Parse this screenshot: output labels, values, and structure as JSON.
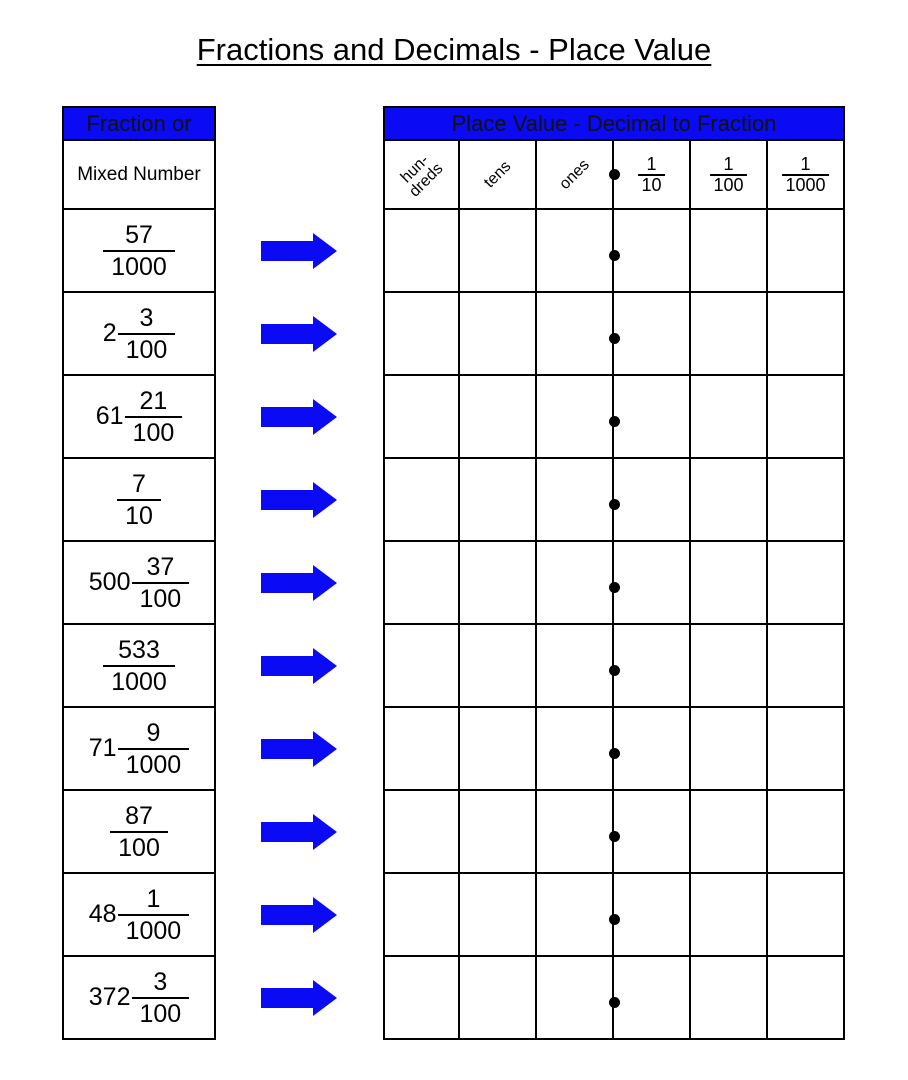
{
  "title": "Fractions and Decimals - Place Value",
  "left_table": {
    "header_line1": "Fraction or",
    "header_line2": "Mixed Number",
    "rows": [
      {
        "whole": "",
        "numerator": "57",
        "denominator": "1000"
      },
      {
        "whole": "2",
        "numerator": "3",
        "denominator": "100"
      },
      {
        "whole": "61",
        "numerator": "21",
        "denominator": "100"
      },
      {
        "whole": "",
        "numerator": "7",
        "denominator": "10"
      },
      {
        "whole": "500",
        "numerator": "37",
        "denominator": "100"
      },
      {
        "whole": "",
        "numerator": "533",
        "denominator": "1000"
      },
      {
        "whole": "71",
        "numerator": "9",
        "denominator": "1000"
      },
      {
        "whole": "",
        "numerator": "87",
        "denominator": "100"
      },
      {
        "whole": "48",
        "numerator": "1",
        "denominator": "1000"
      },
      {
        "whole": "372",
        "numerator": "3",
        "denominator": "100"
      }
    ]
  },
  "arrow_icon": "right-arrow-icon",
  "accent_color": "#0a0af5",
  "right_table": {
    "header": "Place Value - Decimal to Fraction",
    "columns": [
      {
        "type": "text",
        "line1": "hun-",
        "line2": "dreds"
      },
      {
        "type": "text",
        "line1": "tens",
        "line2": ""
      },
      {
        "type": "text",
        "line1": "ones",
        "line2": ""
      },
      {
        "type": "fraction",
        "numerator": "1",
        "denominator": "10"
      },
      {
        "type": "fraction",
        "numerator": "1",
        "denominator": "100"
      },
      {
        "type": "fraction",
        "numerator": "1",
        "denominator": "1000"
      }
    ],
    "row_count": 10,
    "decimal_point_icon": "decimal-point-dot"
  }
}
